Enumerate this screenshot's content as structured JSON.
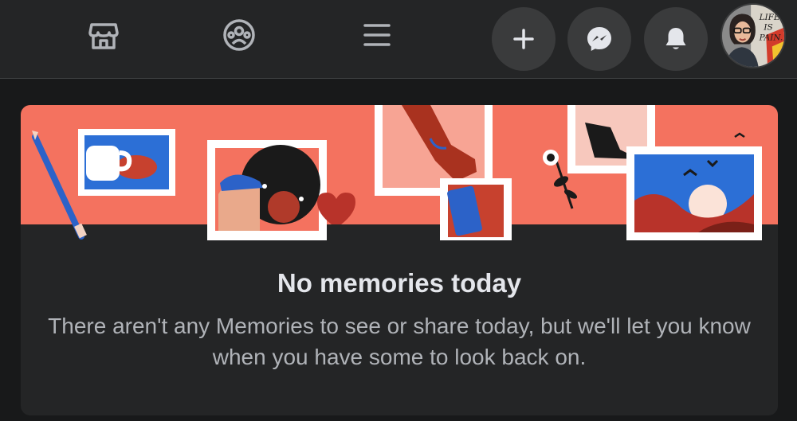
{
  "nav": {
    "icons": [
      "marketplace-icon",
      "groups-icon",
      "menu-icon",
      "create-icon",
      "messenger-icon",
      "notifications-icon"
    ],
    "avatar_caption": "LIFE IS PAIN."
  },
  "memories": {
    "title": "No memories today",
    "description": "There aren't any Memories to see or share today, but we'll let you know when you have some to look back on."
  },
  "colors": {
    "background": "#18191a",
    "surface": "#242526",
    "button": "#3a3b3c",
    "banner_coral": "#f4725f",
    "text_primary": "#e4e6eb",
    "text_secondary": "#b0b3b8"
  }
}
